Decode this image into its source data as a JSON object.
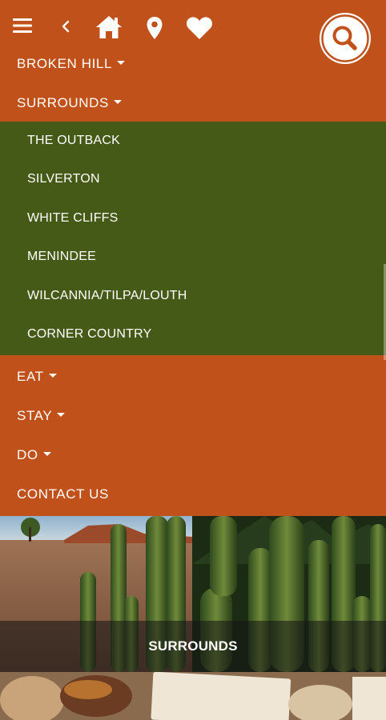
{
  "header": {
    "icons": [
      "hamburger-menu-icon",
      "back-chevron-icon",
      "home-icon",
      "map-pin-icon",
      "heart-icon",
      "search-icon"
    ]
  },
  "menu": {
    "broken_hill": "BROKEN HILL",
    "surrounds": "SURROUNDS",
    "surrounds_items": [
      "THE OUTBACK",
      "SILVERTON",
      "WHITE CLIFFS",
      "MENINDEE",
      "WILCANNIA/TILPA/LOUTH",
      "CORNER COUNTRY"
    ],
    "eat": "EAT",
    "stay": "STAY",
    "do": "DO",
    "contact_us": "CONTACT US"
  },
  "hero": {
    "caption": "SURROUNDS"
  },
  "colors": {
    "primary": "#c0511b",
    "submenu": "#465a18",
    "text": "#ffffff"
  }
}
